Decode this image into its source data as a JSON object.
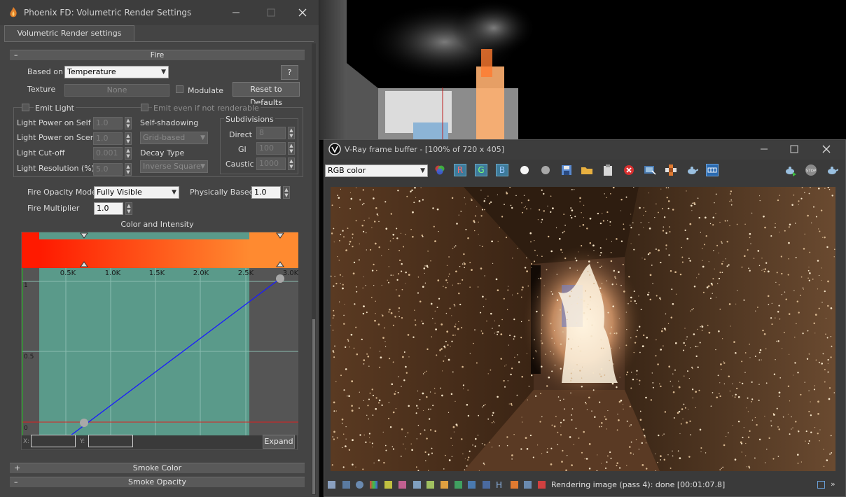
{
  "phoenix": {
    "title": "Phoenix FD: Volumetric Render Settings",
    "tab": "Volumetric Render settings",
    "fire_section": "Fire",
    "based_on_label": "Based on",
    "based_on_value": "Temperature",
    "help_label": "?",
    "texture_label": "Texture",
    "texture_value": "None",
    "modulate_label": "Modulate",
    "reset_label": "Reset to Defaults",
    "emit_light_label": "Emit Light",
    "emit_even_label": "Emit even if not renderable",
    "light_power_self_label": "Light Power on Self",
    "light_power_self_value": "1.0",
    "light_power_scene_label": "Light Power on Scene",
    "light_power_scene_value": "1.0",
    "light_cutoff_label": "Light Cut-off",
    "light_cutoff_value": "0.001",
    "light_resolution_label": "Light Resolution (%)",
    "light_resolution_value": "5.0",
    "self_shadowing_label": "Self-shadowing",
    "self_shadowing_value": "Grid-based",
    "decay_type_label": "Decay Type",
    "decay_type_value": "Inverse Square",
    "subdivisions_label": "Subdivisions",
    "direct_label": "Direct",
    "direct_value": "8",
    "gi_label": "GI",
    "gi_value": "100",
    "caustic_label": "Caustic",
    "caustic_value": "1000",
    "opacity_mode_label": "Fire Opacity Mode",
    "opacity_mode_value": "Fully Visible",
    "physically_based_label": "Physically Based",
    "physically_based_value": "1.0",
    "fire_multiplier_label": "Fire Multiplier",
    "fire_multiplier_value": "1.0",
    "color_intensity_label": "Color and Intensity",
    "x_label": "X:",
    "y_label": "Y:",
    "expand_label": "Expand",
    "smoke_color_label": "Smoke Color",
    "smoke_opacity_label": "Smoke Opacity",
    "plus_sign": "+",
    "minus_sign": "–"
  },
  "curve": {
    "x_ticks": [
      "0.5K",
      "1.0K",
      "1.5K",
      "2.0K",
      "2.5K",
      "3.0K"
    ],
    "y_ticks": [
      "1",
      "0.5",
      "0"
    ]
  },
  "vfb": {
    "title": "V-Ray frame buffer - [100% of 720 x 405]",
    "channel_value": "RGB color",
    "r_label": "R",
    "g_label": "G",
    "b_label": "B",
    "h_label": "H",
    "status": "Rendering image (pass 4): done [00:01:07.8]",
    "stop_label": "STOP"
  },
  "colors": {
    "accent_teal": "#5a9a8a",
    "curve_line": "#1a1aff",
    "fire_gradient_start": "#ff1a00",
    "fire_gradient_end": "#ff8a30"
  }
}
